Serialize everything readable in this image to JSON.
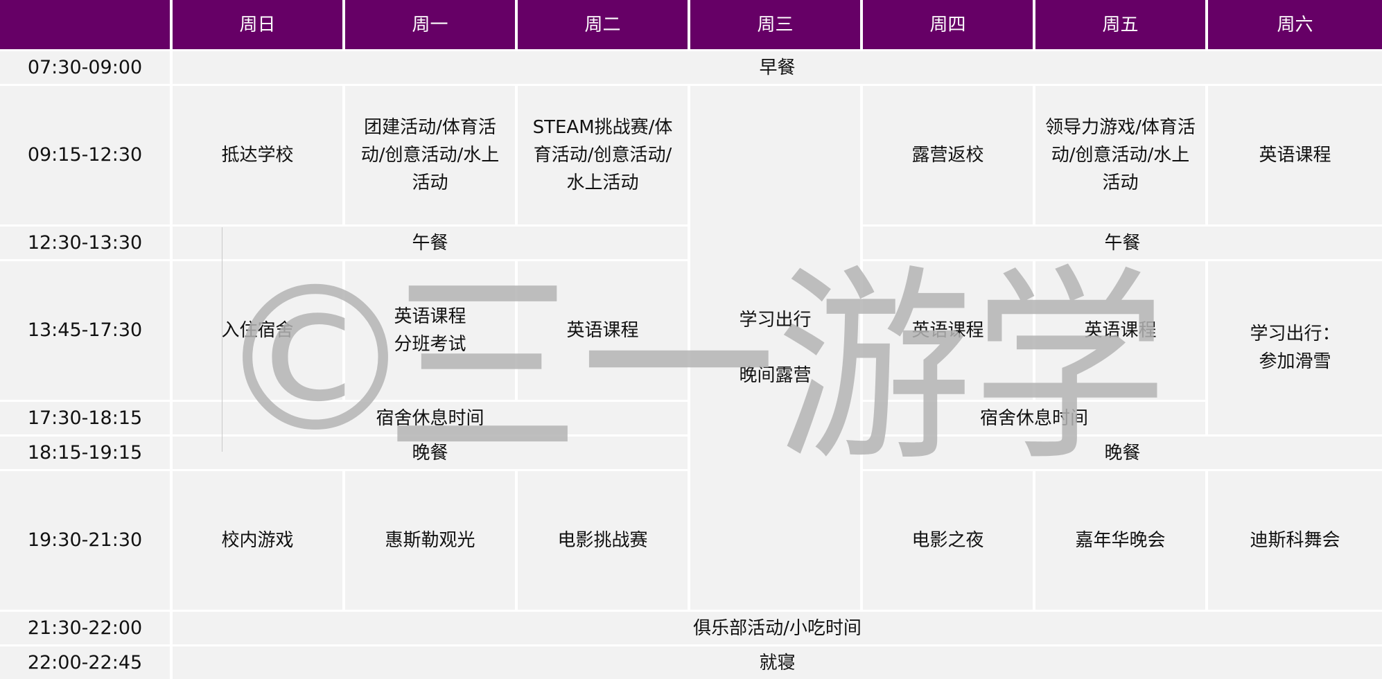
{
  "header": {
    "corner": "",
    "days": [
      "周日",
      "周一",
      "周二",
      "周三",
      "周四",
      "周五",
      "周六"
    ]
  },
  "times": [
    "07:30-09:00",
    "09:15-12:30",
    "12:30-13:30",
    "13:45-17:30",
    "17:30-18:15",
    "18:15-19:15",
    "19:30-21:30",
    "21:30-22:00",
    "22:00-22:45"
  ],
  "cells": {
    "breakfast": "早餐",
    "sun_morning": "抵达学校",
    "mon_morning": "团建活动/体育活动/创意活动/水上活动",
    "tue_morning": "STEAM挑战赛/体育活动/创意活动/水上活动",
    "thu_morning": "露营返校",
    "fri_morning": "领导力游戏/体育活动/创意活动/水上活动",
    "sat_morning": "英语课程",
    "lunch_left": "午餐",
    "lunch_right": "午餐",
    "sun_afternoon": "入住宿舍",
    "mon_afternoon_1": "英语课程",
    "mon_afternoon_2": "分班考试",
    "tue_afternoon": "英语课程",
    "wed_1": "学习出行",
    "wed_2": "晚间露营",
    "thu_afternoon": "英语课程",
    "fri_afternoon": "英语课程",
    "sat_afternoon_1": "学习出行：",
    "sat_afternoon_2": "参加滑雪",
    "rest_left": "宿舍休息时间",
    "rest_right": "宿舍休息时间",
    "dinner_left": "晚餐",
    "dinner_right": "晚餐",
    "sun_evening": "校内游戏",
    "mon_evening": "惠斯勒观光",
    "tue_evening": "电影挑战赛",
    "thu_evening": "电影之夜",
    "fri_evening": "嘉年华晚会",
    "sat_evening": "迪斯科舞会",
    "club": "俱乐部活动/小吃时间",
    "sleep": "就寝"
  },
  "watermark": {
    "symbol": "©",
    "text": "三一游学"
  },
  "colors": {
    "header_bg": "#660066",
    "cell_bg": "#f2f2f2",
    "watermark": "#b4b4b4"
  }
}
